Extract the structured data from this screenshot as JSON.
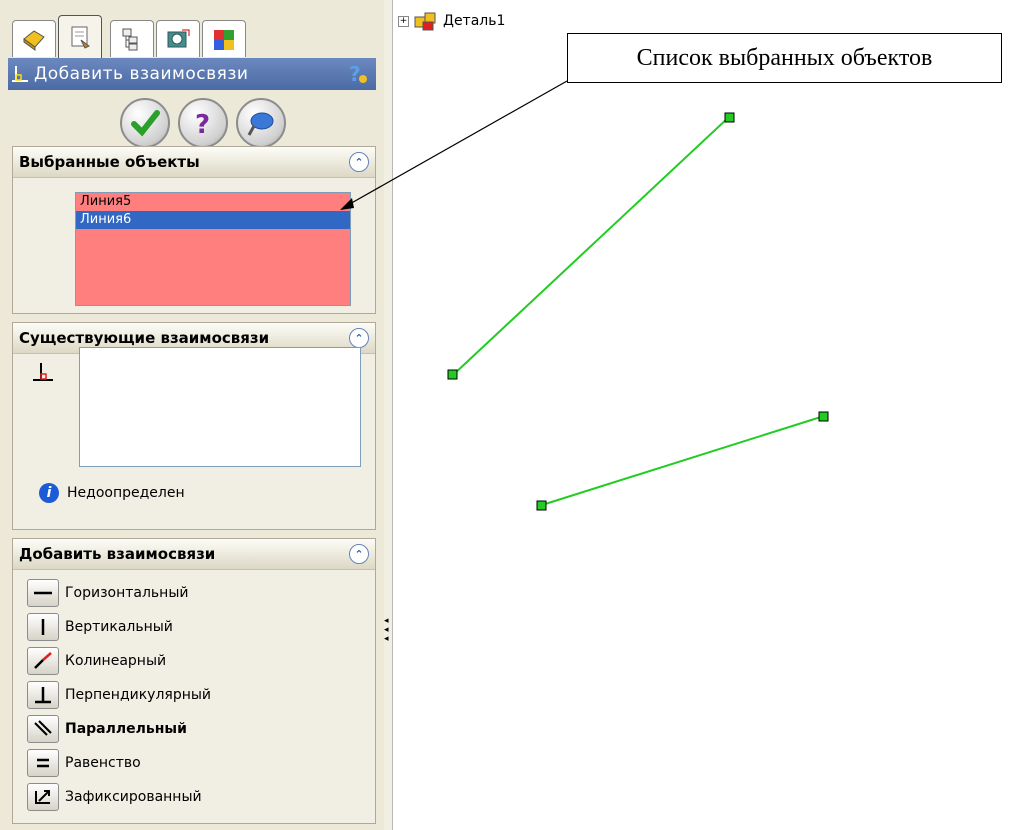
{
  "panel": {
    "tabs": [
      "feature-manager-icon",
      "property-manager-icon",
      "configuration-manager-icon",
      "dimxpert-icon",
      "display-manager-icon"
    ],
    "title": "Добавить взаимосвязи",
    "actions": [
      "ok-icon",
      "help-icon",
      "pushpin-icon"
    ]
  },
  "selected_objects": {
    "header": "Выбранные объекты",
    "items": [
      "Линия5",
      "Линия6"
    ],
    "selected_index": 1,
    "list_color": "#ff7f7f"
  },
  "existing_relations": {
    "header": "Существующие взаимосвязи",
    "status": "Недоопределен"
  },
  "add_relations": {
    "header": "Добавить взаимосвязи",
    "items": [
      {
        "label": "Горизонтальный",
        "icon": "horizontal-icon"
      },
      {
        "label": "Вертикальный",
        "icon": "vertical-icon"
      },
      {
        "label": "Колинеарный",
        "icon": "collinear-icon"
      },
      {
        "label": "Перпендикулярный",
        "icon": "perpendicular-icon"
      },
      {
        "label": "Параллельный",
        "icon": "parallel-icon",
        "bold": true
      },
      {
        "label": "Равенство",
        "icon": "equal-icon"
      },
      {
        "label": "Зафиксированный",
        "icon": "fix-icon"
      }
    ]
  },
  "graphics": {
    "tree_item": "Деталь1",
    "callout": "Список выбранных объектов",
    "line_color": "#22cc22"
  }
}
